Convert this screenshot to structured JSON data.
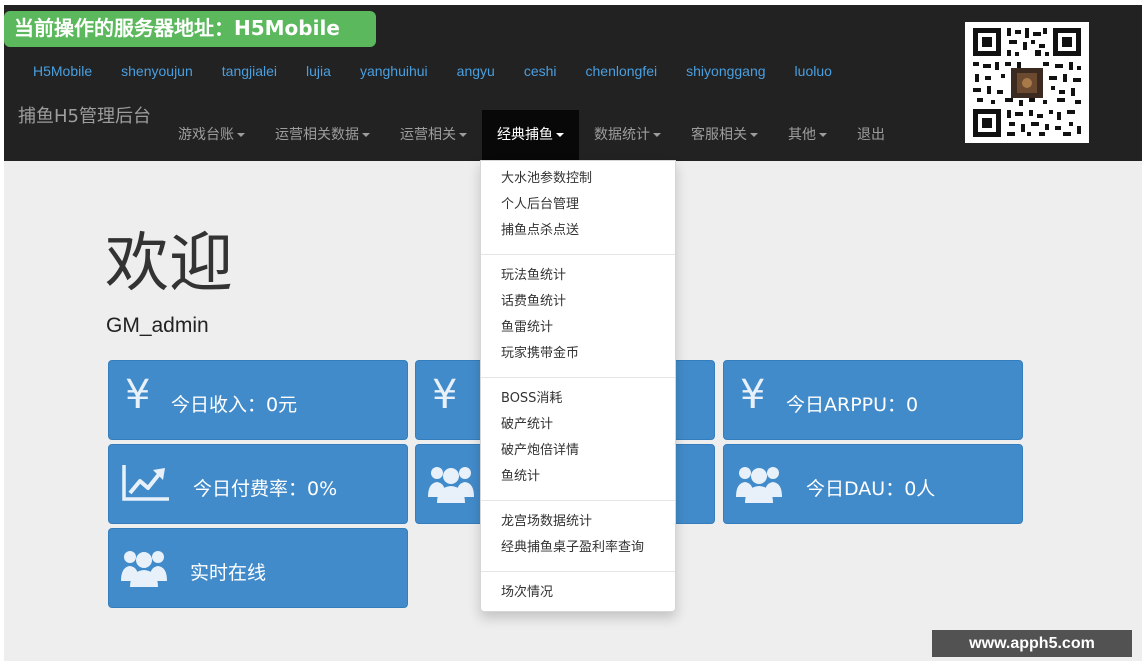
{
  "server_badge": "当前操作的服务器地址：H5Mobile",
  "server_links": [
    "H5Mobile",
    "shenyoujun",
    "tangjialei",
    "lujia",
    "yanghuihui",
    "angyu",
    "ceshi",
    "chenlongfei",
    "shiyonggang",
    "luoluo"
  ],
  "brand": "捕鱼H5管理后台",
  "nav": [
    {
      "label": "游戏台账",
      "caret": true,
      "active": false
    },
    {
      "label": "运营相关数据",
      "caret": true,
      "active": false
    },
    {
      "label": "运营相关",
      "caret": true,
      "active": false
    },
    {
      "label": "经典捕鱼",
      "caret": true,
      "active": true
    },
    {
      "label": "数据统计",
      "caret": true,
      "active": false
    },
    {
      "label": "客服相关",
      "caret": true,
      "active": false
    },
    {
      "label": "其他",
      "caret": true,
      "active": false
    },
    {
      "label": "退出",
      "caret": false,
      "active": false
    }
  ],
  "welcome": "欢迎",
  "username": "GM_admin",
  "tiles": [
    {
      "icon": "yen-icon",
      "label": "今日收入：0元"
    },
    {
      "icon": "yen-icon",
      "label": ""
    },
    {
      "icon": "yen-icon",
      "label": "今日ARPPU：0"
    },
    {
      "icon": "chart-line-icon",
      "label": "今日付费率：0%"
    },
    {
      "icon": "users-icon",
      "label": ""
    },
    {
      "icon": "users-icon",
      "label": "今日DAU：0人"
    },
    {
      "icon": "users-icon",
      "label": "实时在线"
    }
  ],
  "dropdown_groups": [
    [
      "大水池参数控制",
      "个人后台管理",
      "捕鱼点杀点送"
    ],
    [
      "玩法鱼统计",
      "话费鱼统计",
      "鱼雷统计",
      "玩家携带金币"
    ],
    [
      "BOSS消耗",
      "破产统计",
      "破产炮倍详情",
      "鱼统计"
    ],
    [
      "龙宫场数据统计",
      "经典捕鱼桌子盈利率查询"
    ],
    [
      "场次情况"
    ]
  ],
  "watermark": "www.apph5.com",
  "colors": {
    "navbar": "#222222",
    "badge": "#5cb85c",
    "tile": "#428bca",
    "link": "#4a9fe0"
  }
}
